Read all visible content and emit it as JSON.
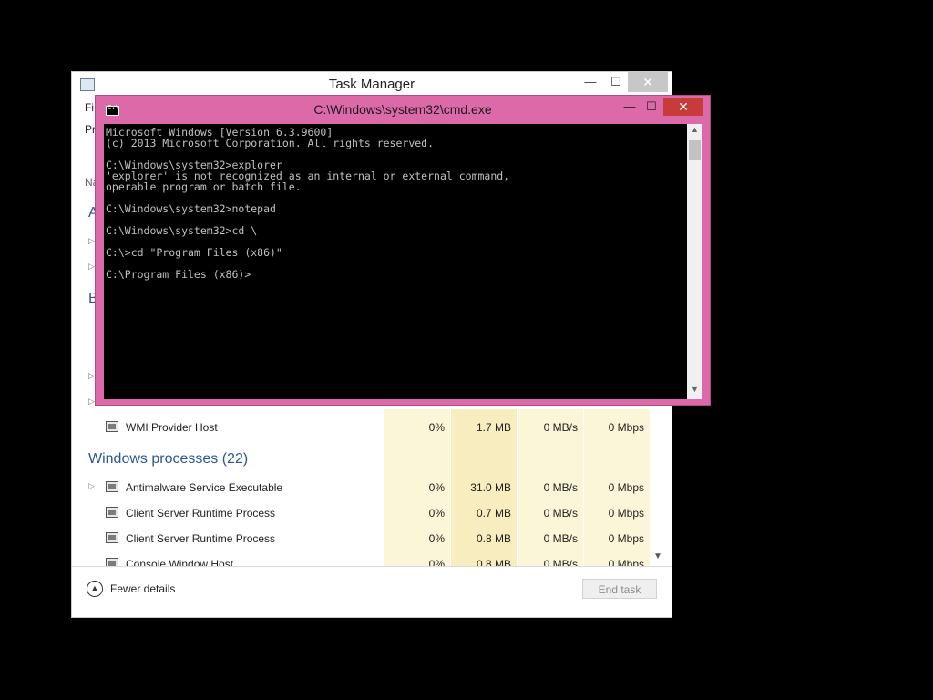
{
  "task_manager": {
    "title": "Task Manager",
    "minimize": "—",
    "maximize": "☐",
    "close": "✕",
    "menu_partial": "Fi",
    "tab_partial": "Pr",
    "column_header_partial": "Na",
    "group_a_partial": "A",
    "group_b_partial": "B",
    "rows": [
      {
        "name": "WMI Provider Host",
        "cpu": "0%",
        "memory": "1.7 MB",
        "disk": "0 MB/s",
        "network": "0 Mbps"
      }
    ],
    "windows_processes_group": "Windows processes (22)",
    "windows_rows": [
      {
        "name": "Antimalware Service Executable",
        "cpu": "0%",
        "memory": "31.0 MB",
        "disk": "0 MB/s",
        "network": "0 Mbps"
      },
      {
        "name": "Client Server Runtime Process",
        "cpu": "0%",
        "memory": "0.7 MB",
        "disk": "0 MB/s",
        "network": "0 Mbps"
      },
      {
        "name": "Client Server Runtime Process",
        "cpu": "0%",
        "memory": "0.8 MB",
        "disk": "0 MB/s",
        "network": "0 Mbps"
      },
      {
        "name": "Console Window Host",
        "cpu": "0%",
        "memory": "0.8 MB",
        "disk": "0 MB/s",
        "network": "0 Mbps"
      }
    ],
    "fewer_details": "Fewer details",
    "end_task": "End task",
    "heat_colors": {
      "light": "#fcf6d8",
      "medium": "#f8edbe"
    }
  },
  "cmd": {
    "title": "C:\\Windows\\system32\\cmd.exe",
    "minimize": "—",
    "maximize": "☐",
    "close": "✕",
    "lines": [
      "Microsoft Windows [Version 6.3.9600]",
      "(c) 2013 Microsoft Corporation. All rights reserved.",
      "",
      "C:\\Windows\\system32>explorer",
      "'explorer' is not recognized as an internal or external command,",
      "operable program or batch file.",
      "",
      "C:\\Windows\\system32>notepad",
      "",
      "C:\\Windows\\system32>cd \\",
      "",
      "C:\\>cd \"Program Files (x86)\"",
      "",
      "C:\\Program Files (x86)>"
    ],
    "frame_color": "#dc6aa8"
  }
}
